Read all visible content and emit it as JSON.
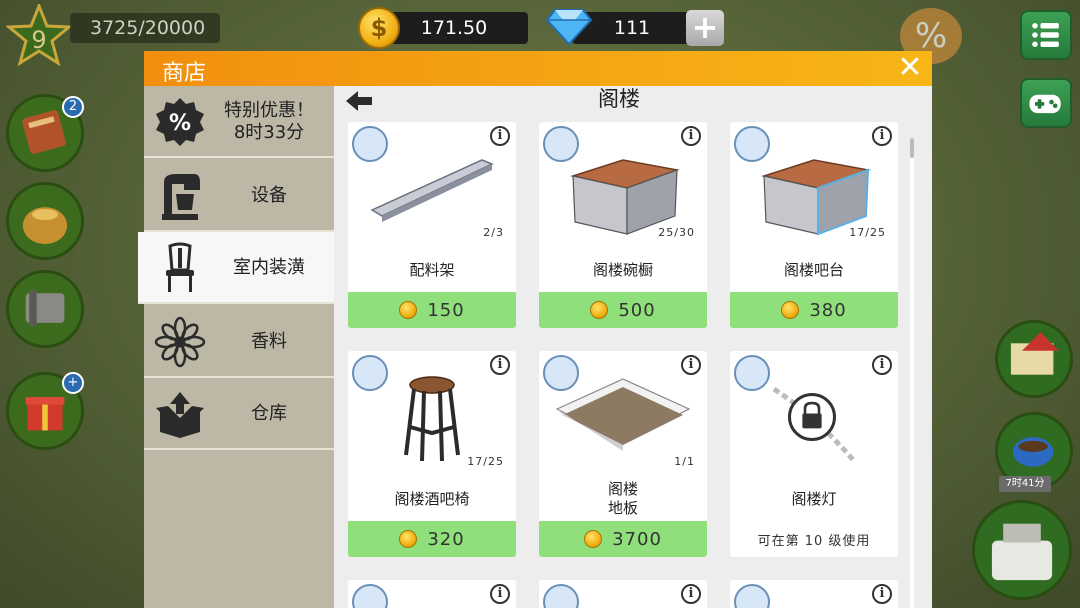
{
  "hud": {
    "level": "9",
    "xp": "3725/20000",
    "coins": "171.50",
    "gems": "111",
    "plus": "+",
    "coin_symbol": "$"
  },
  "side_buttons": {
    "book_badge": "2",
    "gift_badge": "+",
    "timer": "7时41分"
  },
  "shop": {
    "title": "商店",
    "close": "✕",
    "section_title": "阁楼",
    "sidebar": [
      {
        "line1": "特别优惠！",
        "line2": "8时33分",
        "icon": "percent-icon"
      },
      {
        "label": "设备",
        "icon": "mixer-icon"
      },
      {
        "label": "室内装潢",
        "icon": "chair-icon"
      },
      {
        "label": "香料",
        "icon": "star-anise-icon"
      },
      {
        "label": "仓库",
        "icon": "box-icon"
      }
    ],
    "items": [
      {
        "name": "配料架",
        "count": "2/3",
        "price": "150"
      },
      {
        "name": "阁楼碗橱",
        "count": "25/30",
        "price": "500"
      },
      {
        "name": "阁楼吧台",
        "count": "17/25",
        "price": "380"
      },
      {
        "name": "阁楼酒吧椅",
        "count": "17/25",
        "price": "320"
      },
      {
        "name": "阁楼\n地板",
        "count": "1/1",
        "price": "3700"
      },
      {
        "name": "阁楼灯",
        "locked_text": "可在第 10 级使用"
      }
    ],
    "info_glyph": "i"
  }
}
